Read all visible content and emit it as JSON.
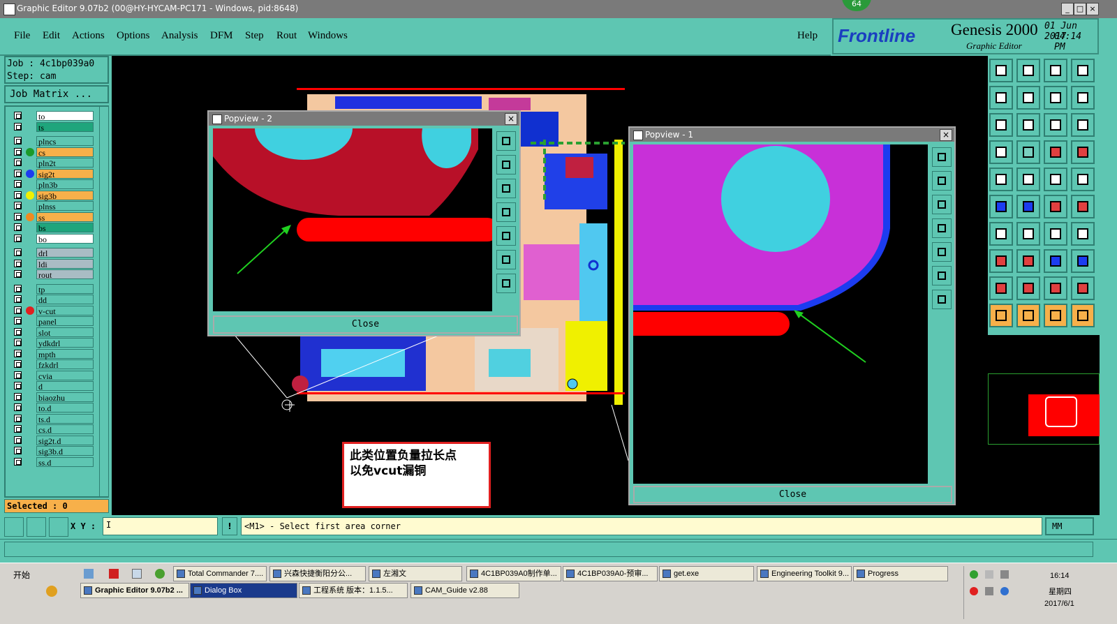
{
  "window": {
    "title": "Graphic Editor 9.07b2 (00@HY-HYCAM-PC171 - Windows, pid:8648)",
    "controls": [
      "_",
      "□",
      "×"
    ],
    "badge": "64"
  },
  "menubar": {
    "items": [
      "File",
      "Edit",
      "Actions",
      "Options",
      "Analysis",
      "DFM",
      "Step",
      "Rout",
      "Windows"
    ],
    "help": "Help"
  },
  "brand": {
    "logo": "Frontline",
    "product": "Genesis 2000",
    "subtitle": "Graphic Editor",
    "date": "01 Jun 2017",
    "time": "04:14 PM"
  },
  "job": {
    "job_label": "Job : 4c1bp039a0",
    "step_label": "Step: cam",
    "matrix_button": "Job Matrix ..."
  },
  "layers": [
    {
      "name": "to",
      "bg": "#ffffff",
      "dot": ""
    },
    {
      "name": "ts",
      "bg": "#1fa57c",
      "dot": ""
    },
    {
      "name": "plncs",
      "bg": "#5ec6b2",
      "dot": ""
    },
    {
      "name": "cs",
      "bg": "#f7b04a",
      "dot": "#1a9a2a"
    },
    {
      "name": "pln2t",
      "bg": "#5ec6b2",
      "dot": ""
    },
    {
      "name": "sig2t",
      "bg": "#f7b04a",
      "dot": "#1c3cf0"
    },
    {
      "name": "pln3b",
      "bg": "#5ec6b2",
      "dot": ""
    },
    {
      "name": "sig3b",
      "bg": "#f7b04a",
      "dot": "#f0f000"
    },
    {
      "name": "plnss",
      "bg": "#5ec6b2",
      "dot": ""
    },
    {
      "name": "ss",
      "bg": "#f7b04a",
      "dot": "#f08a20"
    },
    {
      "name": "bs",
      "bg": "#1fa57c",
      "dot": ""
    },
    {
      "name": "bo",
      "bg": "#ffffff",
      "dot": ""
    },
    {
      "name": "drl",
      "bg": "#a9bcc4",
      "dot": ""
    },
    {
      "name": "ldi",
      "bg": "#a9bcc4",
      "dot": ""
    },
    {
      "name": "rout",
      "bg": "#a9bcc4",
      "dot": ""
    },
    {
      "name": "tp",
      "bg": "#5ec6b2",
      "dot": ""
    },
    {
      "name": "dd",
      "bg": "#5ec6b2",
      "dot": ""
    },
    {
      "name": "v-cut",
      "bg": "#5ec6b2",
      "dot": "#e02020"
    },
    {
      "name": "panel",
      "bg": "#5ec6b2",
      "dot": ""
    },
    {
      "name": "slot",
      "bg": "#5ec6b2",
      "dot": ""
    },
    {
      "name": "ydkdrl",
      "bg": "#5ec6b2",
      "dot": ""
    },
    {
      "name": "mpth",
      "bg": "#5ec6b2",
      "dot": ""
    },
    {
      "name": "fzkdrl",
      "bg": "#5ec6b2",
      "dot": ""
    },
    {
      "name": "cvia",
      "bg": "#5ec6b2",
      "dot": ""
    },
    {
      "name": "d",
      "bg": "#5ec6b2",
      "dot": ""
    },
    {
      "name": "biaozhu",
      "bg": "#5ec6b2",
      "dot": ""
    },
    {
      "name": "to.d",
      "bg": "#5ec6b2",
      "dot": ""
    },
    {
      "name": "ts.d",
      "bg": "#5ec6b2",
      "dot": ""
    },
    {
      "name": "cs.d",
      "bg": "#5ec6b2",
      "dot": ""
    },
    {
      "name": "sig2t.d",
      "bg": "#5ec6b2",
      "dot": ""
    },
    {
      "name": "sig3b.d",
      "bg": "#5ec6b2",
      "dot": ""
    },
    {
      "name": "ss.d",
      "bg": "#5ec6b2",
      "dot": ""
    }
  ],
  "selected": "Selected : 0",
  "popview2": {
    "title": "Popview - 2",
    "close": "Close"
  },
  "popview1": {
    "title": "Popview - 1",
    "close": "Close"
  },
  "annotation": {
    "line1": "此类位置负量拉长点",
    "line2": "以免vcut漏铜"
  },
  "status": {
    "xy_label": "X Y :",
    "xy_value": "I",
    "prompt": "<M1> - Select first area corner",
    "units": "MM"
  },
  "taskbar": {
    "start": "开始",
    "row1": [
      "Total Commander 7....",
      "兴森快捷衡阳分公...",
      "左湘文",
      "4C1BP039A0制作单...",
      "4C1BP039A0-预审...",
      "get.exe",
      "Engineering Toolkit 9...",
      "Progress"
    ],
    "row2": [
      "Graphic Editor 9.07b2 ...",
      "Dialog Box",
      "工程系统  版本：1.1.5...",
      "CAM_Guide v2.88"
    ],
    "clock": "16:14",
    "weekday": "星期四",
    "date": "2017/6/1"
  }
}
